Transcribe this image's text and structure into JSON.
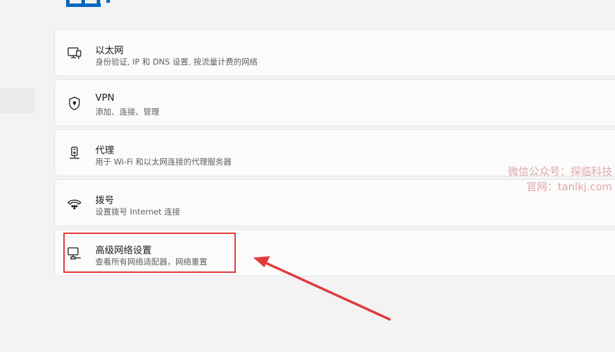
{
  "settings": {
    "items": [
      {
        "title": "以太网",
        "desc": "身份验证, IP 和 DNS 设置, 按流量计费的网络",
        "icon": "ethernet-icon"
      },
      {
        "title": "VPN",
        "desc": "添加、连接、管理",
        "icon": "vpn-shield-icon"
      },
      {
        "title": "代理",
        "desc": "用于 Wi-Fi 和以太网连接的代理服务器",
        "icon": "proxy-icon"
      },
      {
        "title": "拨号",
        "desc": "设置拨号 Internet 连接",
        "icon": "dialup-icon"
      },
      {
        "title": "高级网络设置",
        "desc": "查看所有网络适配器，网络重置",
        "icon": "network-adapter-icon"
      }
    ]
  },
  "annotation": {
    "highlight_color": "#e23a3a",
    "target": "高级网络设置"
  },
  "watermark": {
    "line1": "微信公众号：探临科技",
    "line2": "官网：tanlkj.com"
  },
  "colors": {
    "background": "#f3f3f3",
    "card": "#fbfbfb",
    "accent": "#0067c0"
  }
}
